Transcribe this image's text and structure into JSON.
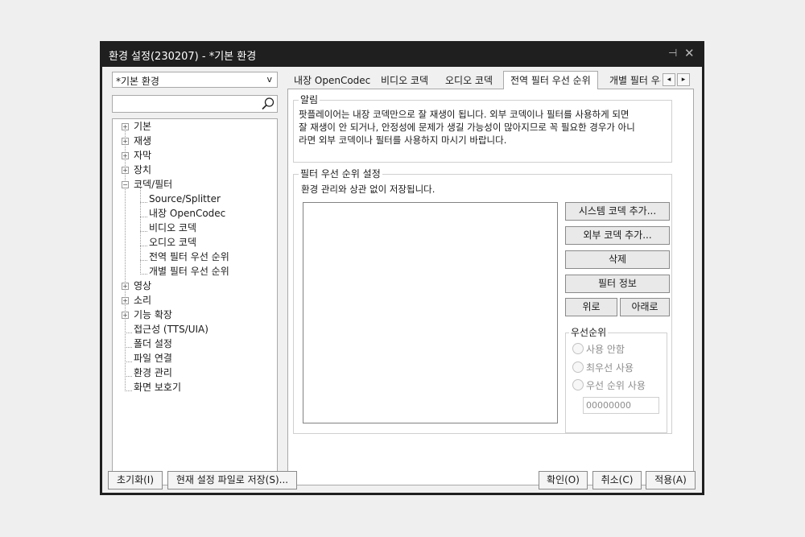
{
  "window": {
    "title": "환경 설정(230207) - *기본 환경",
    "pin_icon": "pin-icon",
    "close_icon": "close-icon"
  },
  "profile": {
    "selected": "*기본 환경",
    "arrow": "v"
  },
  "search": {
    "value": "",
    "icon": "search-icon"
  },
  "tree": {
    "items": [
      "기본",
      "재생",
      "자막",
      "장치",
      "코덱/필터",
      "Source/Splitter",
      "내장 OpenCodec",
      "비디오 코덱",
      "오디오 코덱",
      "전역 필터 우선 순위",
      "개별 필터 우선 순위",
      "영상",
      "소리",
      "기능 확장",
      "접근성 (TTS/UIA)",
      "폴더 설정",
      "파일 연결",
      "환경 관리",
      "화면 보호기"
    ],
    "expand_glyph": "+",
    "collapse_glyph": "−"
  },
  "tabs": [
    "내장 OpenCodec",
    "비디오 코덱",
    "오디오 코덱",
    "전역 필터 우선 순위",
    "개별 필터 우선 순위"
  ],
  "tab_scroll": {
    "left": "◂",
    "right": "▸"
  },
  "notice": {
    "title": "알림",
    "lines": [
      "팟플레이어는 내장 코덱만으로 잘 재생이 됩니다. 외부 코덱이나 필터를 사용하게 되면",
      "잘 재생이 안 되거나, 안정성에 문제가 생길 가능성이 많아지므로 꼭 필요한 경우가 아니",
      "라면 외부 코덱이나 필터를 사용하지 마시기 바랍니다."
    ]
  },
  "filter_priority": {
    "title": "필터 우선 순위 설정",
    "subtitle": "환경 관리와 상관 없이 저장됩니다.",
    "buttons": {
      "add_system": "시스템 코덱 추가...",
      "add_external": "외부 코덱 추가...",
      "delete": "삭제",
      "info": "필터 정보",
      "up": "위로",
      "down": "아래로"
    },
    "priority": {
      "title": "우선순위",
      "options": [
        "사용 안함",
        "최우선 사용",
        "우선 순위 사용"
      ],
      "value": "00000000"
    }
  },
  "footer": {
    "reset": "초기화(I)",
    "save_file": "현재 설정 파일로 저장(S)...",
    "ok": "확인(O)",
    "cancel": "취소(C)",
    "apply": "적용(A)"
  }
}
